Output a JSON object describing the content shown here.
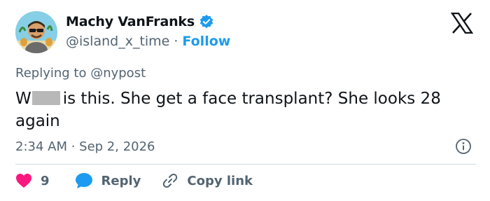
{
  "user": {
    "display_name": "Machy VanFranks",
    "handle": "@island_x_time",
    "separator": "·",
    "follow_label": "Follow"
  },
  "reply": {
    "replying_to": "Replying to @nypost"
  },
  "tweet": {
    "text_start": "W",
    "text_rest": "is this. She get a face transplant? She looks 28 again",
    "timestamp": "2:34 AM · Sep 2, 2026"
  },
  "actions": {
    "like_count": "9",
    "reply_label": "Reply",
    "copy_label": "Copy link"
  },
  "icons": {
    "verified": "verified-badge-icon",
    "x_logo": "x-logo-icon",
    "info": "info-icon",
    "heart": "heart-icon",
    "reply": "reply-bubble-icon",
    "link": "link-icon"
  },
  "colors": {
    "accent": "#1d9bf0",
    "like": "#f91880",
    "text": "#0f1419",
    "muted": "#536471"
  }
}
